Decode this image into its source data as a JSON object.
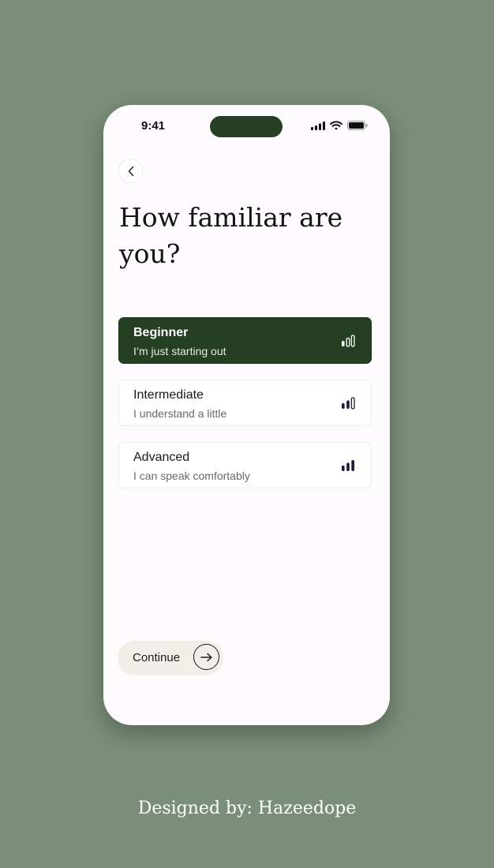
{
  "status_bar": {
    "time": "9:41"
  },
  "header": {
    "title": "How familiar are you?"
  },
  "options": [
    {
      "title": "Beginner",
      "subtitle": "I’m just starting out",
      "selected": true,
      "level": 1
    },
    {
      "title": "Intermediate",
      "subtitle": "I understand a little",
      "selected": false,
      "level": 2
    },
    {
      "title": "Advanced",
      "subtitle": "I can speak comfortably",
      "selected": false,
      "level": 3
    }
  ],
  "continue_button": {
    "label": "Continue"
  },
  "footer": {
    "credit": "Designed by: Hazeedope"
  },
  "colors": {
    "accent": "#243f22",
    "background": "#7a8e79",
    "surface": "#fdfbfd"
  },
  "icons": [
    "chevron-left-icon",
    "signal-icon",
    "wifi-icon",
    "battery-icon",
    "level-bars-icon",
    "arrow-right-icon"
  ]
}
